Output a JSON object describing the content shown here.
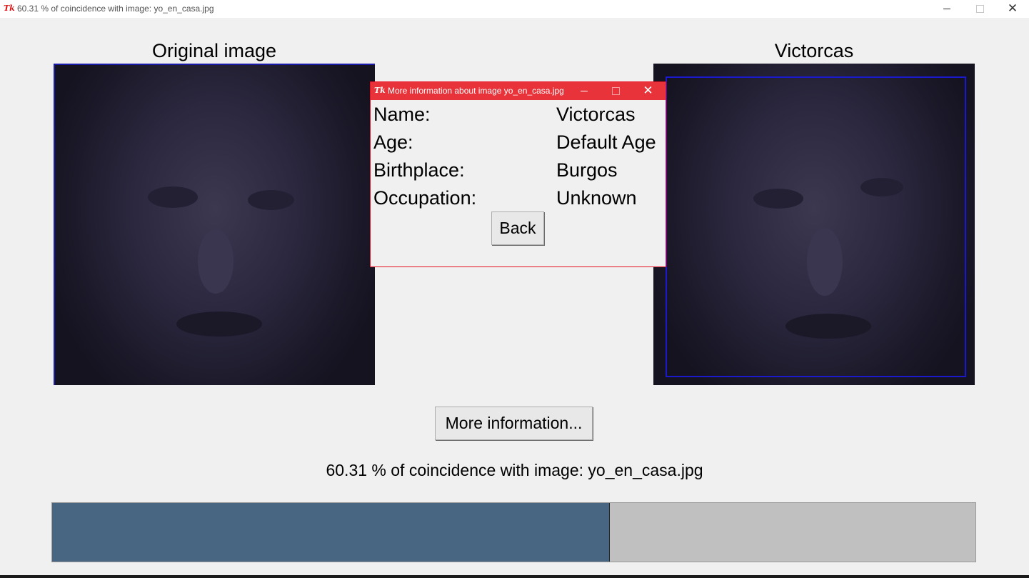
{
  "window": {
    "title": "60.31 % of coincidence with image: yo_en_casa.jpg",
    "logo": "Tk"
  },
  "images": {
    "original_label": "Original image",
    "match_label": "Victorcas"
  },
  "dialog": {
    "title": "More information about image yo_en_casa.jpg",
    "logo": "Tk",
    "fields": [
      {
        "label": "Name:",
        "value": "Victorcas"
      },
      {
        "label": "Age:",
        "value": "Default Age"
      },
      {
        "label": "Birthplace:",
        "value": "Burgos"
      },
      {
        "label": "Occupation:",
        "value": "Unknown"
      }
    ],
    "back_label": "Back"
  },
  "more_info_label": "More information...",
  "status_text": "60.31 % of coincidence with image: yo_en_casa.jpg",
  "progress": {
    "percent": 60.31,
    "fill_color": "#486681",
    "track_color": "#c0c0c0"
  },
  "colors": {
    "face_box": "#1a1acc",
    "dialog_titlebar": "#e8333a"
  },
  "icons": [
    "tk-feather-icon",
    "minimize-icon",
    "maximize-icon",
    "close-icon"
  ]
}
